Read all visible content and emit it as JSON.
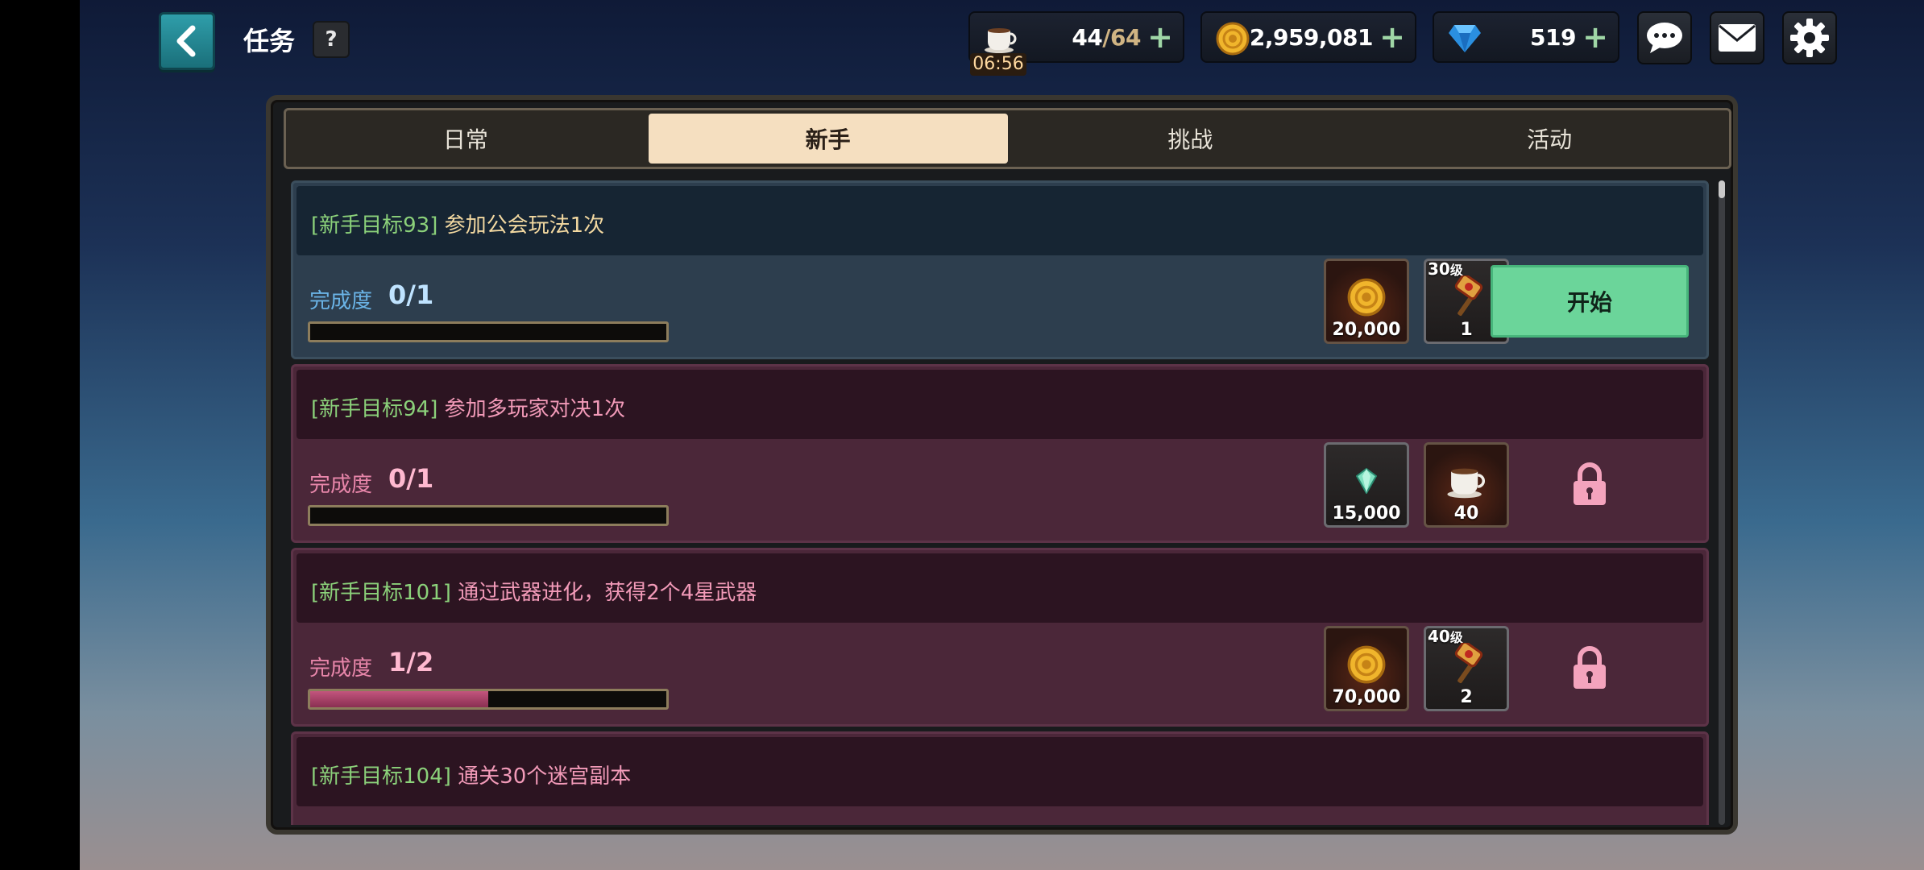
{
  "header": {
    "title": "任务",
    "help_label": "?"
  },
  "resources": {
    "stamina": {
      "value": "44",
      "max": "/64",
      "timer": "06:56",
      "icon": "coffee-cup-icon"
    },
    "gold": {
      "value": "2,959,081",
      "icon": "gold-coin-icon"
    },
    "gems": {
      "value": "519",
      "icon": "blue-gem-icon"
    },
    "plus": "+"
  },
  "tabs": [
    {
      "label": "日常",
      "active": false
    },
    {
      "label": "新手",
      "active": true
    },
    {
      "label": "挑战",
      "active": false
    },
    {
      "label": "活动",
      "active": false
    }
  ],
  "tasks": [
    {
      "tag": "[新手目标93]",
      "title": "参加公会玩法1次",
      "progress_label": "完成度",
      "progress_text": "0/1",
      "progress": 0,
      "state": "available",
      "rewards": [
        {
          "icon": "gold-coin-icon",
          "count": "20,000"
        },
        {
          "icon": "weapon-hammer-icon",
          "level": "30",
          "level_suffix": "级",
          "count": "1"
        }
      ],
      "button_label": "开始"
    },
    {
      "tag": "[新手目标94]",
      "title": "参加多玩家对决1次",
      "progress_label": "完成度",
      "progress_text": "0/1",
      "progress": 0,
      "state": "locked",
      "rewards": [
        {
          "icon": "green-crystal-icon",
          "count": "15,000"
        },
        {
          "icon": "coffee-cup-icon",
          "count": "40"
        }
      ]
    },
    {
      "tag": "[新手目标101]",
      "title": "通过武器进化，获得2个4星武器",
      "progress_label": "完成度",
      "progress_text": "1/2",
      "progress": 0.5,
      "state": "locked",
      "rewards": [
        {
          "icon": "gold-coin-icon",
          "count": "70,000"
        },
        {
          "icon": "weapon-hammer-icon",
          "level": "40",
          "level_suffix": "级",
          "count": "2"
        }
      ]
    },
    {
      "tag": "[新手目标104]",
      "title": "通关30个迷宫副本",
      "state": "locked"
    }
  ],
  "colors": {
    "accent_green": "#6bd59a",
    "active_tab": "#f5dfc0",
    "tag_green": "#8bd17a"
  }
}
